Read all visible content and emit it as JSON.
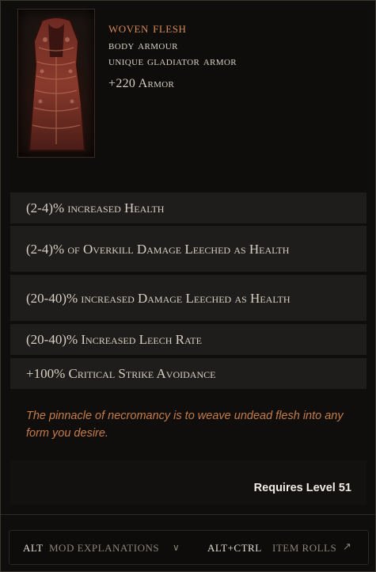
{
  "item": {
    "name": "Woven Flesh",
    "slot": "Body Armour",
    "rarity": "Unique Gladiator Armor",
    "implicit": "+220 Armor",
    "image_icon": "flesh-armor-icon"
  },
  "affixes": [
    "(2-4)% increased Health",
    "(2-4)% of Overkill Damage Leeched as Health",
    "(20-40)% increased Damage Leeched as Health",
    "(20-40)% Increased Leech Rate",
    "+100% Critical Strike Avoidance"
  ],
  "lore": "The pinnacle of necromancy is to weave undead flesh into any form you desire.",
  "requirement": "Requires Level 51",
  "footer": {
    "alt_key": "ALT",
    "alt_label": "MOD EXPLANATIONS",
    "alt_icon": "chevron-down-icon",
    "ctrl_key": "ALT+CTRL",
    "ctrl_label": "ITEM ROLLS",
    "ctrl_icon": "arrow-up-right-icon"
  },
  "colors": {
    "unique_name": "#d58a53",
    "lore": "#c57c47",
    "affix_bg": "#1e1d1b"
  }
}
